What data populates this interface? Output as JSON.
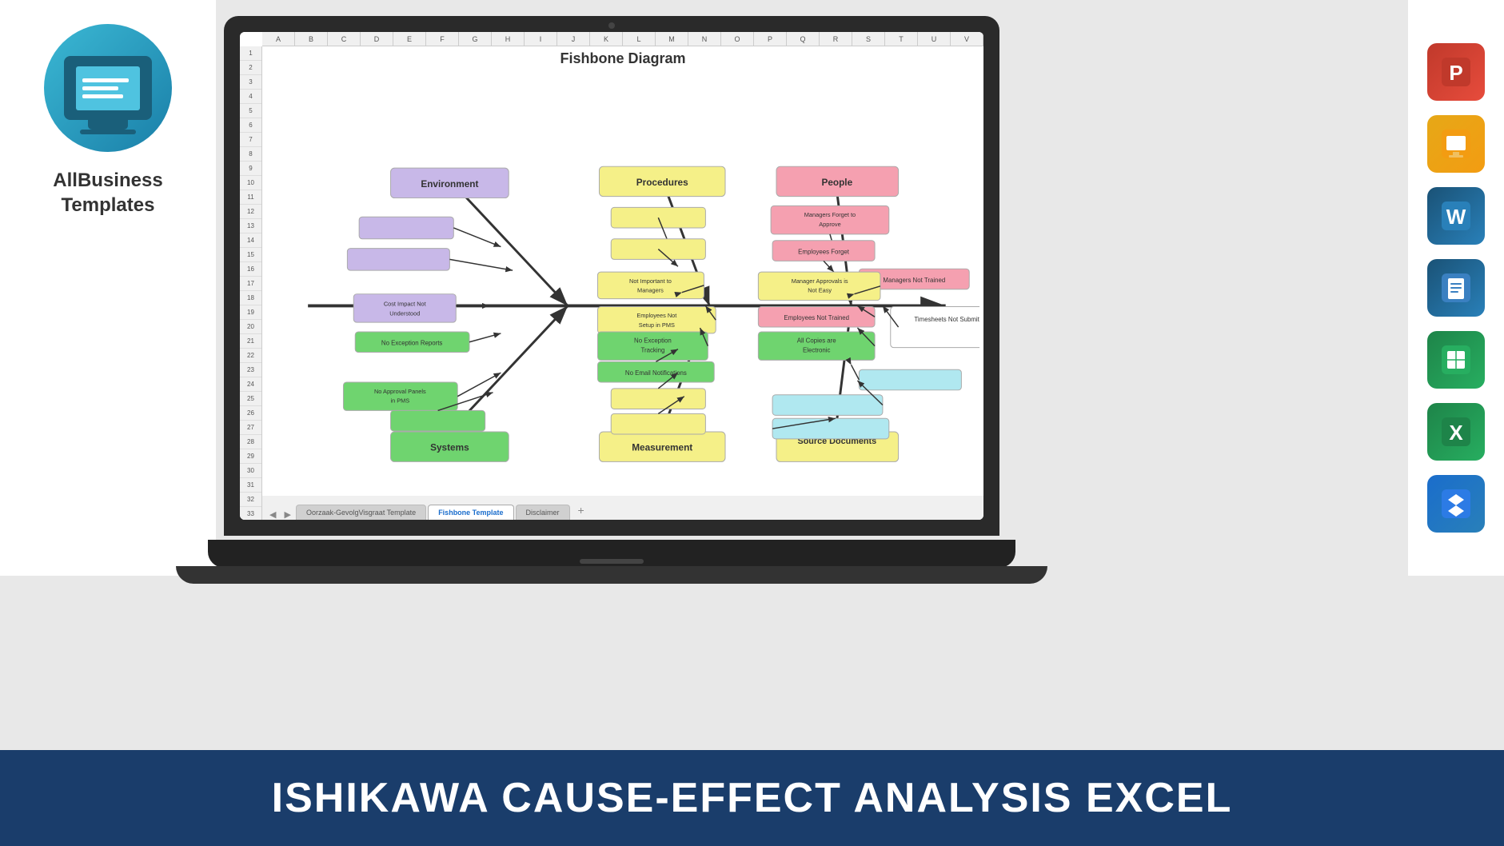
{
  "brand": {
    "name": "AllBusiness\nTemplates",
    "logo_alt": "AllBusiness Templates Logo"
  },
  "diagram": {
    "title": "Fishbone Diagram",
    "categories": {
      "environment": "Environment",
      "procedures": "Procedures",
      "people": "People",
      "systems": "Systems",
      "measurement": "Measurement",
      "source_documents": "Source Documents"
    },
    "boxes": {
      "managers_forget_approve": "Managers Forget to Approve",
      "employees_forget": "Employees Forget",
      "managers_not_trained": "Managers Not Trained",
      "manager_approvals_not_easy": "Manager Approvals is Not Easy",
      "employees_not_trained": "Employees Not Trained",
      "timesheets_not_submitted": "Timesheets Not Submitted",
      "cost_impact_not_understood": "Cost Impact Not Understood",
      "not_important_to_managers": "Not Important to Managers",
      "employees_not_setup_pms": "Employees Not Setup in PMS",
      "no_exception_reports": "No Exception Reports",
      "no_exception_tracking": "No Exception Tracking",
      "all_copies_electronic": "All Copies are Electronic",
      "no_email_notifications": "No Email Notifications",
      "no_approval_panels_pms": "No Approval Panels in PMS"
    }
  },
  "tabs": {
    "tab1": "Oorzaak-GevolgVisgraat Template",
    "tab2": "Fishbone Template",
    "tab3": "Disclaimer",
    "add": "+"
  },
  "banner": {
    "text": "ISHIKAWA CAUSE-EFFECT ANALYSIS  EXCEL"
  },
  "app_icons": [
    {
      "name": "PowerPoint",
      "class": "icon-ppt",
      "symbol": "P"
    },
    {
      "name": "Google Slides",
      "class": "icon-slides",
      "symbol": "G"
    },
    {
      "name": "Word",
      "class": "icon-word",
      "symbol": "W"
    },
    {
      "name": "Google Docs",
      "class": "icon-docs",
      "symbol": "D"
    },
    {
      "name": "Google Sheets",
      "class": "icon-sheets",
      "symbol": "S"
    },
    {
      "name": "Excel",
      "class": "icon-excel",
      "symbol": "X"
    },
    {
      "name": "Dropbox",
      "class": "icon-dropbox",
      "symbol": "◆"
    }
  ],
  "colors": {
    "accent_blue": "#1a3d6b",
    "laptop_dark": "#2a2a2a",
    "tab_active_color": "#1a6dcc"
  }
}
